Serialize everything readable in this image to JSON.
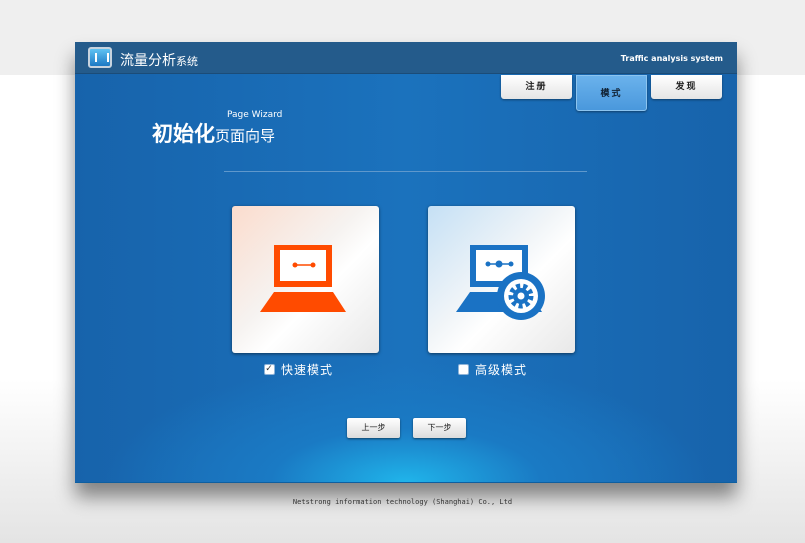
{
  "header": {
    "title_main": "流量分析",
    "title_small": "系统",
    "subtitle": "Traffic analysis system"
  },
  "tabs": [
    {
      "label": "注册"
    },
    {
      "label": "模式",
      "active": true
    },
    {
      "label": "发现"
    }
  ],
  "wizard": {
    "title_bold": "初始化",
    "title_rest": "页面向导",
    "title_en": "Page Wizard"
  },
  "options": [
    {
      "label": "快速模式",
      "checked": true,
      "icon": "laptop-icon",
      "color": "#ff4b00"
    },
    {
      "label": "高级模式",
      "checked": false,
      "icon": "laptop-gear-icon",
      "color": "#1a72c4"
    }
  ],
  "buttons": {
    "prev": "上一步",
    "next": "下一步"
  },
  "footer": "Netstrong information technology (Shanghai) Co., Ltd"
}
